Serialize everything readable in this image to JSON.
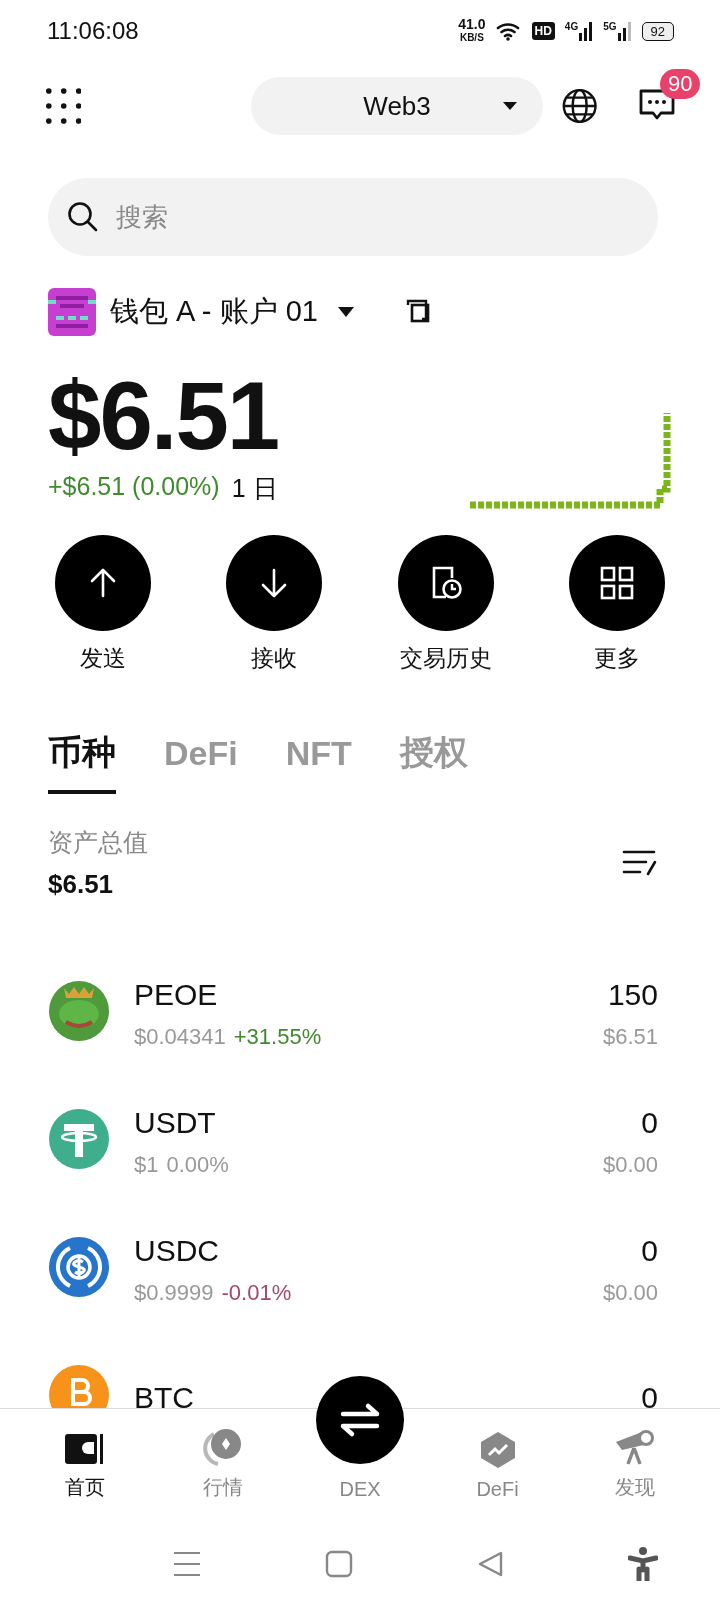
{
  "status_bar": {
    "time": "11:06:08",
    "speed": "41.0",
    "speed_unit": "KB/S",
    "hd": "HD",
    "net_4g": "4G",
    "net_5g": "5G",
    "battery": "92"
  },
  "top_bar": {
    "network": "Web3",
    "badge": "90"
  },
  "search": {
    "placeholder": "搜索"
  },
  "wallet": {
    "name": "钱包 A - 账户 01"
  },
  "balance": {
    "value": "$6.51",
    "change": "+$6.51 (0.00%)",
    "period": "1 日"
  },
  "actions": [
    {
      "kind": "send",
      "label": "发送"
    },
    {
      "kind": "receive",
      "label": "接收"
    },
    {
      "kind": "history",
      "label": "交易历史"
    },
    {
      "kind": "more",
      "label": "更多"
    }
  ],
  "tabs": [
    {
      "label": "币种",
      "selected": true
    },
    {
      "label": "DeFi",
      "selected": false
    },
    {
      "label": "NFT",
      "selected": false
    },
    {
      "label": "授权",
      "selected": false
    }
  ],
  "total": {
    "label": "资产总值",
    "value": "$6.51"
  },
  "tokens": [
    {
      "kind": "frog",
      "name": "PEOE",
      "price": "$0.04341",
      "change": "+31.55%",
      "color": "#3f8a2c",
      "amount": "150",
      "value": "$6.51"
    },
    {
      "kind": "tether",
      "name": "USDT",
      "price": "$1",
      "change": "0.00%",
      "color": "#999999",
      "amount": "0",
      "value": "$0.00"
    },
    {
      "kind": "usdc",
      "name": "USDC",
      "price": "$0.9999",
      "change": "-0.01%",
      "color": "#a34a6a",
      "amount": "0",
      "value": "$0.00"
    },
    {
      "kind": "btc",
      "name": "BTC",
      "amount": "0"
    }
  ],
  "bottom_nav": [
    {
      "kind": "wallet",
      "label": "首页",
      "selected": true
    },
    {
      "kind": "market",
      "label": "行情",
      "selected": false
    },
    {
      "kind": "swap",
      "label": "DEX",
      "selected": false
    },
    {
      "kind": "defi",
      "label": "DeFi",
      "selected": false
    },
    {
      "kind": "discover",
      "label": "发现",
      "selected": false
    }
  ]
}
